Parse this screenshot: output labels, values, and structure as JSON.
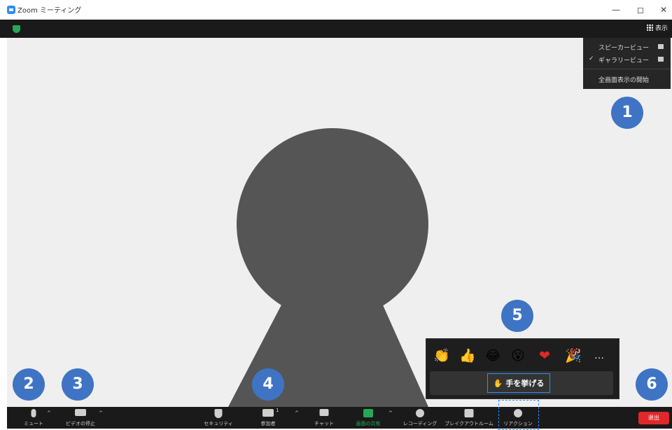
{
  "window": {
    "title": "Zoom ミーティング",
    "minimize": "—",
    "restore": "◻",
    "close": "✕"
  },
  "topbar": {
    "view_label": "表示"
  },
  "view_menu": {
    "items": [
      {
        "label": "スピーカービュー",
        "checked": false
      },
      {
        "label": "ギャラリービュー",
        "checked": true
      },
      {
        "label": "全画面表示の開始",
        "checked": false
      }
    ],
    "check_mark": "✓"
  },
  "badges": {
    "b1": "1",
    "b2": "2",
    "b3": "3",
    "b4": "4",
    "b5": "5",
    "b6": "6"
  },
  "reactions": {
    "emojis": [
      "👏",
      "👍",
      "😂",
      "😮",
      "❤",
      "🎉",
      "…"
    ],
    "raise_hand_icon": "✋",
    "raise_hand_label": "手を挙げる"
  },
  "toolbar": {
    "mute": "ミュート",
    "video": "ビデオの停止",
    "security": "セキュリティ",
    "participants": "参加者",
    "participants_count": "1",
    "chat": "チャット",
    "share": "画面の共有",
    "record": "レコーディング",
    "breakout": "ブレイクアウトルーム",
    "reactions": "リアクション",
    "leave": "退出"
  },
  "colors": {
    "badge": "#3f74c4",
    "share_green": "#25a955",
    "leave_red": "#e02828",
    "accent_blue": "#2d8cff"
  }
}
